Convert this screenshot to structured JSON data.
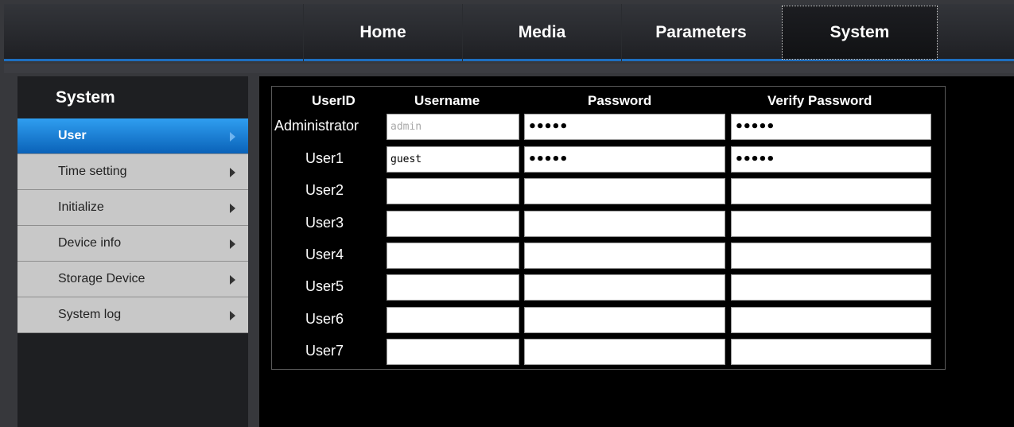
{
  "nav": {
    "items": [
      {
        "label": "Home",
        "active": false
      },
      {
        "label": "Media",
        "active": false
      },
      {
        "label": "Parameters",
        "active": false
      },
      {
        "label": "System",
        "active": true
      }
    ]
  },
  "sidebar": {
    "title": "System",
    "items": [
      {
        "label": "User",
        "active": true
      },
      {
        "label": "Time setting",
        "active": false
      },
      {
        "label": "Initialize",
        "active": false
      },
      {
        "label": "Device info",
        "active": false
      },
      {
        "label": "Storage Device",
        "active": false
      },
      {
        "label": "System log",
        "active": false
      }
    ]
  },
  "users": {
    "headers": {
      "userid": "UserID",
      "username": "Username",
      "password": "Password",
      "verify": "Verify Password"
    },
    "rows": [
      {
        "id": "Administrator",
        "username": "admin",
        "password": "•••••",
        "verify": "•••••"
      },
      {
        "id": "User1",
        "username": "guest",
        "password": "•••••",
        "verify": "•••••"
      },
      {
        "id": "User2",
        "username": "",
        "password": "",
        "verify": ""
      },
      {
        "id": "User3",
        "username": "",
        "password": "",
        "verify": ""
      },
      {
        "id": "User4",
        "username": "",
        "password": "",
        "verify": ""
      },
      {
        "id": "User5",
        "username": "",
        "password": "",
        "verify": ""
      },
      {
        "id": "User6",
        "username": "",
        "password": "",
        "verify": ""
      },
      {
        "id": "User7",
        "username": "",
        "password": "",
        "verify": ""
      }
    ]
  },
  "colors": {
    "accent": "#1e6fc0",
    "active_item": "#0a62b8",
    "sidebar_item_bg": "#c8c8c8"
  }
}
